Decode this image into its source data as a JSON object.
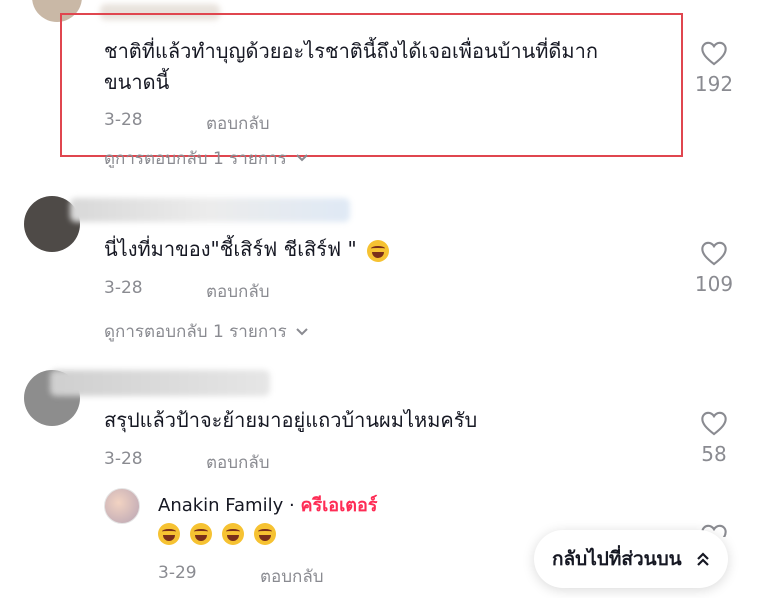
{
  "comments": [
    {
      "text_line1": "ชาติที่แล้วทำบุญด้วยอะไรชาตินี้ถึงได้เจอเพื่อนบ้านที่ดีมาก",
      "text_line2": "ขนาดนี้",
      "date": "3-28",
      "reply_label": "ตอบกลับ",
      "likes": "192",
      "view_replies": "ดูการตอบกลับ 1 รายการ"
    },
    {
      "text": "นี่ไงที่มาของ\"ชี้เสิร์ฟ ชีเสิร์ฟ \"",
      "emoji": "rolling-laughing-emoji",
      "date": "3-28",
      "reply_label": "ตอบกลับ",
      "likes": "109",
      "view_replies": "ดูการตอบกลับ 1 รายการ"
    },
    {
      "text": "สรุปแล้วป้าจะย้ายมาอยู่แถวบ้านผมไหมครับ",
      "date": "3-28",
      "reply_label": "ตอบกลับ",
      "likes": "58"
    }
  ],
  "creator_reply": {
    "name": "Anakin Family",
    "separator": "·",
    "badge": "ครีเอเตอร์",
    "emoji_count": 4,
    "date": "3-29",
    "reply_label": "ตอบกลับ"
  },
  "back_to_top": {
    "label": "กลับไปที่ส่วนบน",
    "icon": "chevron-double-up-icon"
  },
  "colors": {
    "highlight_border": "#e0464f",
    "creator_badge": "#fe2c55",
    "secondary_text": "#8a8b91"
  }
}
